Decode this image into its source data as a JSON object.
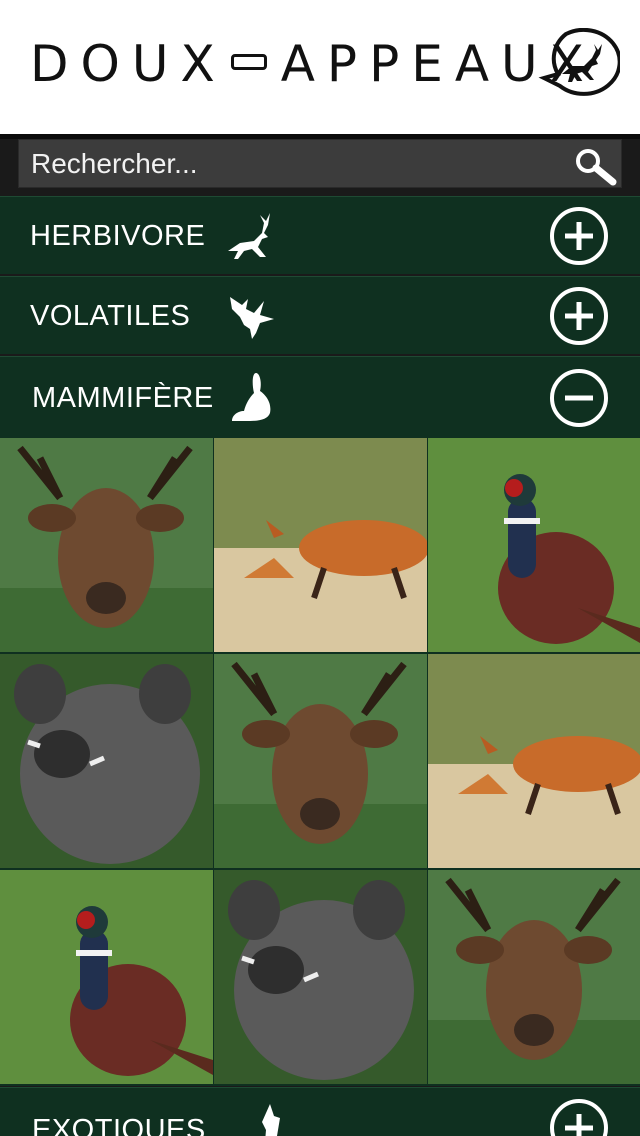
{
  "header": {
    "brand_left": "DOUX",
    "brand_right": "APPEAUX"
  },
  "search": {
    "placeholder": "Rechercher..."
  },
  "categories": [
    {
      "label": "HERBIVORE",
      "icon": "deer-icon",
      "state": "collapsed"
    },
    {
      "label": "VOLATILES",
      "icon": "bird-icon",
      "state": "collapsed"
    },
    {
      "label": "MAMMIFÈRE",
      "icon": "rabbit-icon",
      "state": "expanded"
    },
    {
      "label": "EXOTIQUES",
      "icon": "kangaroo-icon",
      "state": "collapsed"
    }
  ],
  "grid": {
    "tiles": [
      {
        "animal": "deer"
      },
      {
        "animal": "fox"
      },
      {
        "animal": "pheasant"
      },
      {
        "animal": "boar"
      },
      {
        "animal": "deer"
      },
      {
        "animal": "fox"
      },
      {
        "animal": "pheasant"
      },
      {
        "animal": "boar"
      },
      {
        "animal": "deer"
      }
    ]
  },
  "colors": {
    "category_bar": "#0f3020",
    "search_bg": "#3c3c3c",
    "header_bg": "#ffffff"
  }
}
